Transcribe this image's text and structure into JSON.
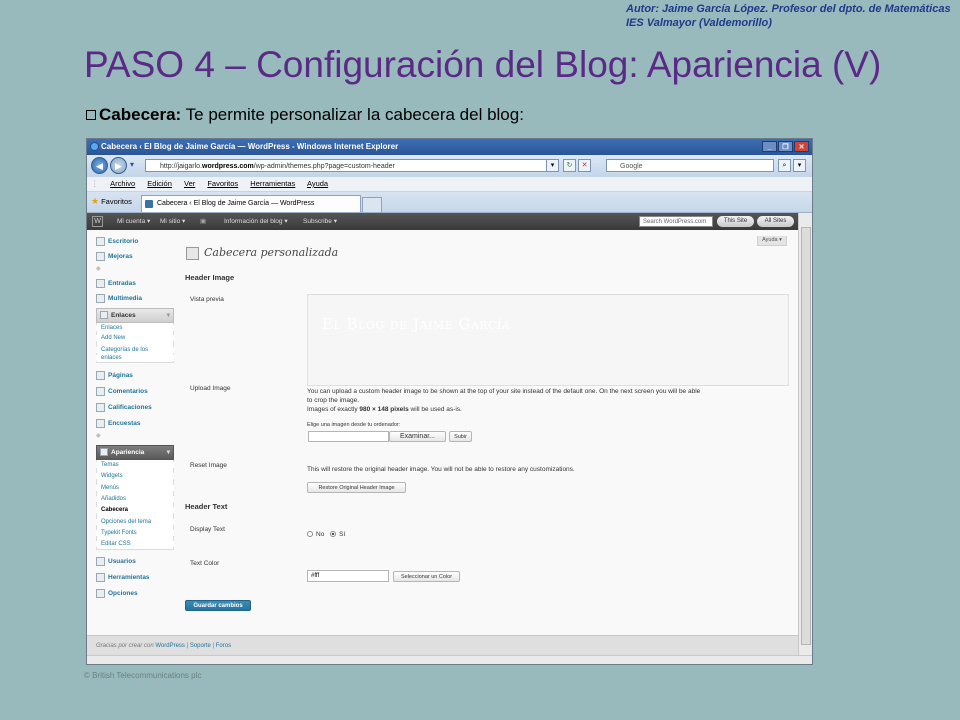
{
  "slide": {
    "author_line1": "Autor: Jaime García López. Profesor del dpto. de Matemáticas",
    "author_line2": "IES Valmayor (Valdemorillo)",
    "title": "PASO 4 – Configuración del Blog: Apariencia (V)",
    "bullet_bold": "Cabecera:",
    "bullet_text": " Te permite personalizar la cabecera del blog:",
    "copyright": "© British Telecommunications plc"
  },
  "browser": {
    "window_title": "Cabecera ‹ El Blog de Jaime García — WordPress - Windows Internet Explorer",
    "url_prefix": "http://jaigarlo.",
    "url_domain": "wordpress.com",
    "url_suffix": "/wp-admin/themes.php?page=custom-header",
    "search_placeholder": "Google",
    "menu": [
      "Archivo",
      "Edición",
      "Ver",
      "Favoritos",
      "Herramientas",
      "Ayuda"
    ],
    "favorites_label": "Favoritos",
    "tab_title": "Cabecera ‹ El Blog de Jaime García — WordPress"
  },
  "wpbar": {
    "items": [
      "Mi cuenta ▾",
      "Mi sitio ▾",
      "Información del blog ▾",
      "Subscribe ▾"
    ],
    "search_placeholder": "Search WordPress.com",
    "this_site": "This Site",
    "all_sites": "All Sites"
  },
  "sidebar": {
    "escritorio": "Escritorio",
    "mejoras": "Mejoras",
    "entradas": "Entradas",
    "multimedia": "Multimedia",
    "enlaces": "Enlaces",
    "enlaces_sub": [
      "Enlaces",
      "Add New",
      "Categorías de los",
      "enlaces"
    ],
    "paginas": "Páginas",
    "comentarios": "Comentarios",
    "calificaciones": "Calificaciones",
    "encuestas": "Encuestas",
    "apariencia": "Apariencia",
    "apariencia_sub": [
      "Temas",
      "Widgets",
      "Menús",
      "Añadidos",
      "Cabecera",
      "Opciones del tema",
      "Typekit Fonts",
      "Editar CSS"
    ],
    "usuarios": "Usuarios",
    "herramientas": "Herramientas",
    "opciones": "Opciones"
  },
  "main": {
    "help": "Ayuda ▾",
    "page_title": "Cabecera personalizada",
    "header_image_heading": "Header Image",
    "preview_label": "Vista previa",
    "preview_text": "El Blog de Jaime García",
    "upload_label": "Upload Image",
    "upload_desc_1": "You can upload a custom header image to be shown at the top of your site instead of the default one. On the next screen you will be able",
    "upload_desc_2": "to crop the image.",
    "upload_desc_3a": "Images of exactly ",
    "upload_desc_3b": "980 × 148 pixels",
    "upload_desc_3c": " will be used as-is.",
    "choose_image": "Elige una imagen desde tu ordenador:",
    "browse_button": "Examinar...",
    "upload_button": "Subir",
    "reset_label": "Reset Image",
    "reset_desc": "This will restore the original header image. You will not be able to restore any customizations.",
    "restore_button": "Restore Original Header Image",
    "header_text_heading": "Header Text",
    "display_text_label": "Display Text",
    "radio_no": "No",
    "radio_si": "Sí",
    "text_color_label": "Text Color",
    "text_color_value": "#fff",
    "select_color_button": "Seleccionar un Color",
    "save_button": "Guardar cambios"
  },
  "footer": {
    "prefix": "Gracias por crear con ",
    "wordpress": "WordPress",
    "sep1": " | ",
    "soporte": "Soporte",
    "sep2": " | ",
    "foros": "Foros"
  }
}
